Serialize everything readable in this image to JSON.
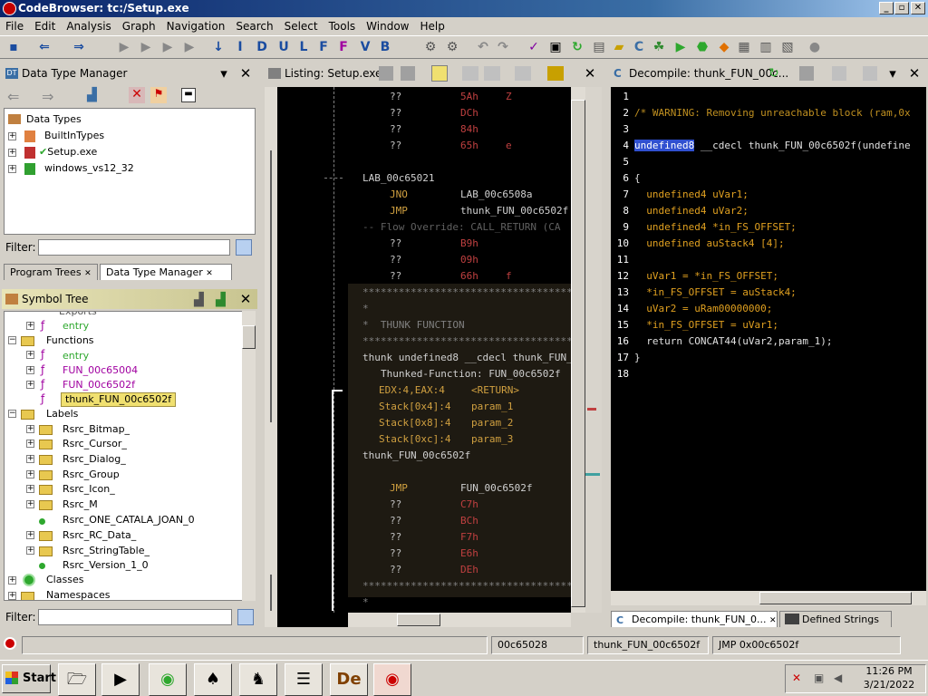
{
  "window": {
    "title": "CodeBrowser: tc:/Setup.exe"
  },
  "menu": [
    "File",
    "Edit",
    "Analysis",
    "Graph",
    "Navigation",
    "Search",
    "Select",
    "Tools",
    "Window",
    "Help"
  ],
  "data_type_manager": {
    "title": "Data Type Manager",
    "root": "Data Types",
    "items": [
      "BuiltInTypes",
      "Setup.exe",
      "windows_vs12_32"
    ],
    "filter_label": "Filter:"
  },
  "tabs_left": {
    "program_trees": "Program Trees",
    "data_type_manager": "Data Type Manager"
  },
  "symbol_tree": {
    "title": "Symbol Tree",
    "exports_label": "Exports",
    "exports_entry": "entry",
    "functions_label": "Functions",
    "functions": [
      "entry",
      "FUN_00c65004",
      "FUN_00c6502f",
      "thunk_FUN_00c6502f"
    ],
    "labels_label": "Labels",
    "labels": [
      "Rsrc_Bitmap_",
      "Rsrc_Cursor_",
      "Rsrc_Dialog_",
      "Rsrc_Group",
      "Rsrc_Icon_",
      "Rsrc_M",
      "Rsrc_ONE_CATALA_JOAN_0",
      "Rsrc_RC_Data_",
      "Rsrc_StringTable_",
      "Rsrc_Version_1_0"
    ],
    "classes_label": "Classes",
    "namespaces_label": "Namespaces",
    "filter_label": "Filter:"
  },
  "listing": {
    "title": "Listing:  Setup.exe",
    "rows": [
      {
        "c1": "??",
        "c2": "5Ah",
        "c3": "Z"
      },
      {
        "c1": "??",
        "c2": "DCh",
        "c3": ""
      },
      {
        "c1": "??",
        "c2": "84h",
        "c3": ""
      },
      {
        "c1": "??",
        "c2": "65h",
        "c3": "e"
      }
    ],
    "label1": "LAB_00c65021",
    "jno": {
      "op": "JNO",
      "arg": "LAB_00c6508a"
    },
    "jmp1": {
      "op": "JMP",
      "arg": "thunk_FUN_00c6502f"
    },
    "flow_override": "-- Flow Override: CALL_RETURN (CA",
    "rows2": [
      {
        "c1": "??",
        "c2": "B9h",
        "c3": ""
      },
      {
        "c1": "??",
        "c2": "09h",
        "c3": ""
      },
      {
        "c1": "??",
        "c2": "66h",
        "c3": "f"
      }
    ],
    "stars": "*************************************",
    "star": "*",
    "thunk_comment": "*  THUNK FUNCTION",
    "sig": "thunk undefined8 __cdecl thunk_FUN_",
    "thunked": "Thunked-Function: FUN_00c6502f",
    "params": [
      {
        "loc": "EDX:4,EAX:4",
        "name": "<RETURN>"
      },
      {
        "loc": "Stack[0x4]:4",
        "name": "param_1"
      },
      {
        "loc": "Stack[0x8]:4",
        "name": "param_2"
      },
      {
        "loc": "Stack[0xc]:4",
        "name": "param_3"
      }
    ],
    "func_label": "thunk_FUN_00c6502f",
    "jmp2": {
      "op": "JMP",
      "arg": "FUN_00c6502f"
    },
    "rows3": [
      {
        "c1": "??",
        "c2": "C7h"
      },
      {
        "c1": "??",
        "c2": "BCh"
      },
      {
        "c1": "??",
        "c2": "F7h"
      },
      {
        "c1": "??",
        "c2": "E6h"
      },
      {
        "c1": "??",
        "c2": "DEh"
      }
    ]
  },
  "decompile": {
    "title": "Decompile: thunk_FUN_00c...",
    "lines": [
      "",
      "/* WARNING: Removing unreachable block (ram,0x",
      "",
      "undefined8 __cdecl thunk_FUN_00c6502f(undefine",
      "",
      "{",
      "  undefined4 uVar1;",
      "  undefined4 uVar2;",
      "  undefined4 *in_FS_OFFSET;",
      "  undefined auStack4 [4];",
      "",
      "  uVar1 = *in_FS_OFFSET;",
      "  *in_FS_OFFSET = auStack4;",
      "  uVar2 = uRam00000000;",
      "  *in_FS_OFFSET = uVar1;",
      "  return CONCAT44(uVar2,param_1);",
      "}",
      ""
    ],
    "tab1": "Decompile: thunk_FUN_0...",
    "tab2": "Defined Strings"
  },
  "status": {
    "addr": "00c65028",
    "func": "thunk_FUN_00c6502f",
    "instr": "JMP 0x00c6502f"
  },
  "taskbar": {
    "start": "Start",
    "time": "11:26 PM",
    "date": "3/21/2022"
  },
  "colors": {
    "selection": "#0a246a",
    "listing_bg": "#000000",
    "thunk_bg": "#1e1a12"
  }
}
